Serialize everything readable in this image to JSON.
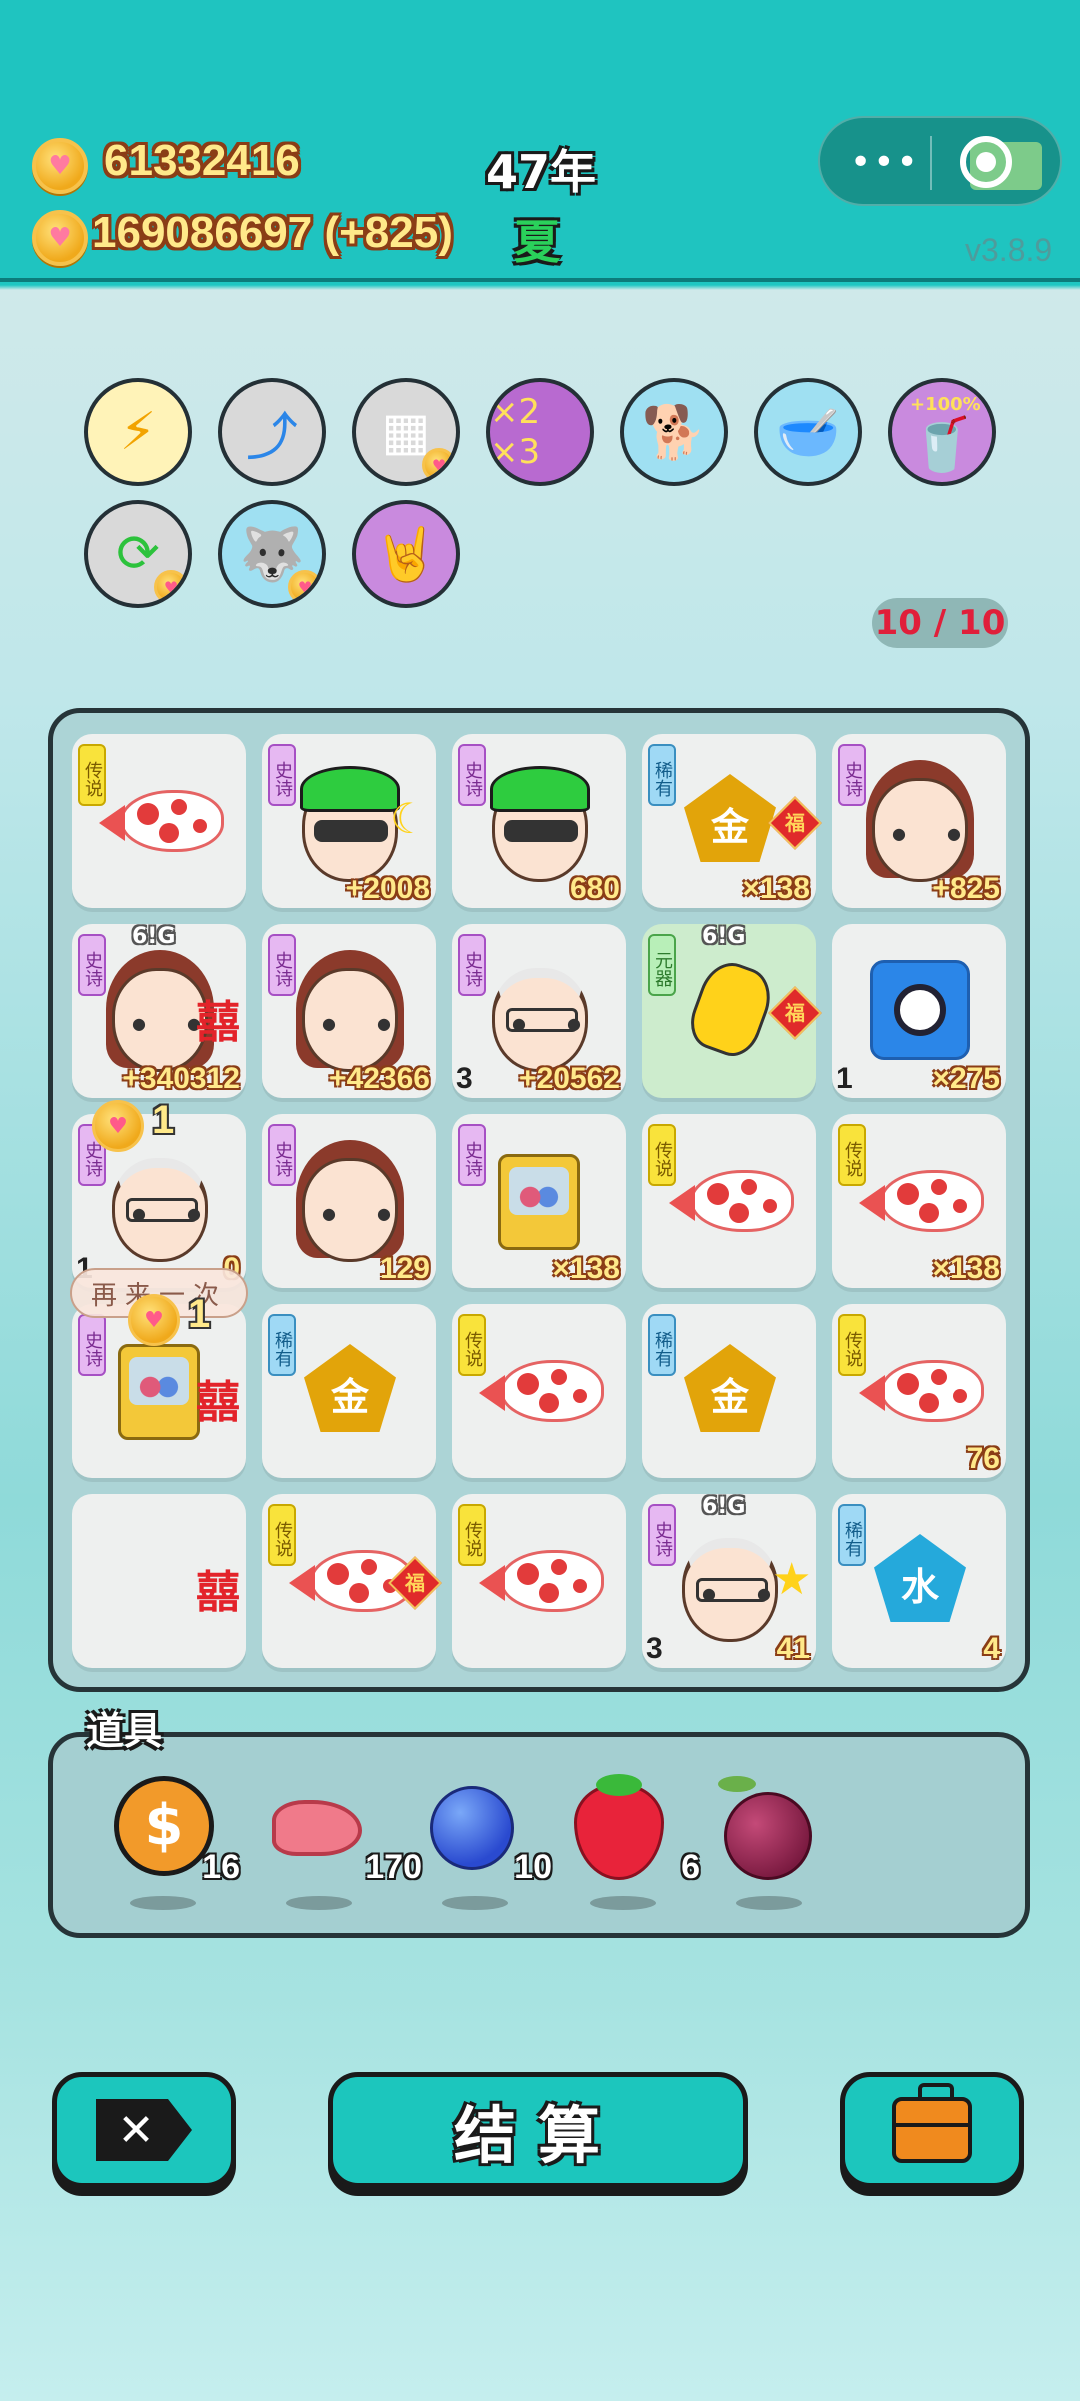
{
  "header": {
    "coins": "61332416",
    "income": "169086697 (+825)",
    "year": "47年",
    "season": "夏",
    "version": "v3.8.9"
  },
  "skills_counter": "10 / 10",
  "grid": [
    {
      "tag": "传说",
      "tier": "legend",
      "item": "fish",
      "value": "",
      "left_num": ""
    },
    {
      "tag": "史诗",
      "tier": "epic",
      "item": "green-cap-man",
      "value": "+2008",
      "left_num": ""
    },
    {
      "tag": "史诗",
      "tier": "epic",
      "item": "green-cap-man",
      "value": "680",
      "left_num": ""
    },
    {
      "tag": "稀有",
      "tier": "rare",
      "item": "gold-pentagon",
      "icon_text": "金",
      "value": "×138",
      "left_num": ""
    },
    {
      "tag": "史诗",
      "tier": "epic",
      "item": "braided-girl",
      "value": "+825",
      "left_num": ""
    },
    {
      "tag": "史诗",
      "tier": "epic",
      "item": "braided-girl",
      "value": "+340312",
      "left_num": ""
    },
    {
      "tag": "史诗",
      "tier": "epic",
      "item": "braided-girl",
      "value": "+42366",
      "left_num": ""
    },
    {
      "tag": "史诗",
      "tier": "epic",
      "item": "old-man",
      "value": "+20562",
      "left_num": "3"
    },
    {
      "tag": "元器",
      "tier": "yuan",
      "item": "pointing-hand",
      "value": "",
      "left_num": ""
    },
    {
      "tag": "",
      "tier": "",
      "item": "stopwatch",
      "value": "×275",
      "left_num": "1"
    },
    {
      "tag": "史诗",
      "tier": "epic",
      "item": "old-man",
      "value": "0",
      "left_num": "1"
    },
    {
      "tag": "史诗",
      "tier": "epic",
      "item": "braided-girl",
      "value": "129",
      "left_num": ""
    },
    {
      "tag": "史诗",
      "tier": "epic",
      "item": "gacha",
      "value": "×138",
      "left_num": ""
    },
    {
      "tag": "传说",
      "tier": "legend",
      "item": "fish",
      "value": "",
      "left_num": ""
    },
    {
      "tag": "传说",
      "tier": "legend",
      "item": "fish",
      "value": "×138",
      "left_num": ""
    },
    {
      "tag": "史诗",
      "tier": "epic",
      "item": "gacha",
      "value": "",
      "left_num": ""
    },
    {
      "tag": "稀有",
      "tier": "rare",
      "item": "gold-pentagon",
      "icon_text": "金",
      "value": "",
      "left_num": ""
    },
    {
      "tag": "传说",
      "tier": "legend",
      "item": "fish",
      "value": "",
      "left_num": ""
    },
    {
      "tag": "稀有",
      "tier": "rare",
      "item": "gold-pentagon",
      "icon_text": "金",
      "value": "",
      "left_num": ""
    },
    {
      "tag": "传说",
      "tier": "legend",
      "item": "fish",
      "value": "76",
      "left_num": ""
    },
    {
      "tag": "",
      "tier": "",
      "item": "empty",
      "value": "",
      "left_num": ""
    },
    {
      "tag": "传说",
      "tier": "legend",
      "item": "fish",
      "value": "",
      "left_num": ""
    },
    {
      "tag": "传说",
      "tier": "legend",
      "item": "fish",
      "value": "",
      "left_num": ""
    },
    {
      "tag": "史诗",
      "tier": "epic",
      "item": "old-man",
      "value": "41",
      "left_num": "3"
    },
    {
      "tag": "稀有",
      "tier": "rare",
      "item": "water-pentagon",
      "icon_text": "水",
      "value": "4",
      "left_num": ""
    }
  ],
  "badges": {
    "xi": "囍",
    "fu": "福",
    "six_g": "6!G",
    "coin_count_1": "1",
    "coin_count_2": "1",
    "retry": "再来一次",
    "pct": "+100%"
  },
  "tools": {
    "title": "道具",
    "items": [
      {
        "name": "dollar-coin",
        "count": "16"
      },
      {
        "name": "liver",
        "count": "170"
      },
      {
        "name": "blueberry",
        "count": "10"
      },
      {
        "name": "strawberry",
        "count": "6"
      },
      {
        "name": "lychee",
        "count": ""
      }
    ]
  },
  "actions": {
    "settle": "结算"
  }
}
